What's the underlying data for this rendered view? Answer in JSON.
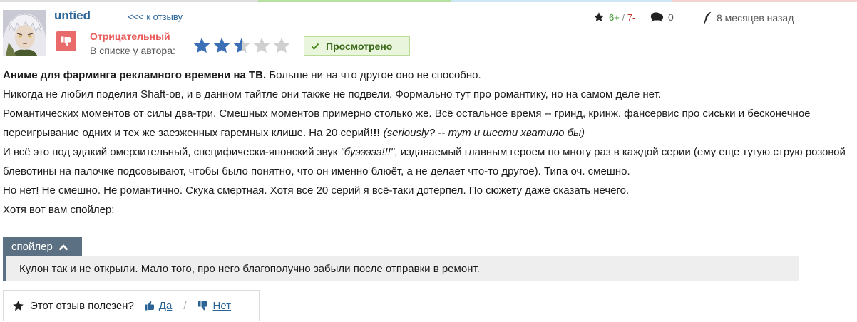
{
  "colors": {
    "topline": [
      "#dedede",
      "#b8e0a0",
      "#cde7f5",
      "#f4d3d3"
    ],
    "accent_link": "#2a6496",
    "negative": "#e85c5c",
    "star_filled": "#3b6fb6",
    "star_empty": "#d0d0d0",
    "spoiler": "#5b7183"
  },
  "author": {
    "username": "untied",
    "back_link": "<<< к отзыву"
  },
  "rating": {
    "verdict": "Отрицательный",
    "in_list_label": "В списке у автора:",
    "stars_value": 2.5,
    "stars_max": 5
  },
  "status_badge": "Просмотрено",
  "meta": {
    "score_pos": "6+",
    "score_sep": "/",
    "score_neg": "7-",
    "comments": "0",
    "time": "8 месяцев назад"
  },
  "review": {
    "p1_bold": "Аниме для фарминга рекламного времени на ТВ.",
    "p1_rest": " Больше ни на что другое оно не способно.",
    "p2": "Никогда не любил поделия Shaft-ов, и в данном тайтле они также не подвели. Формально тут про романтику, но на самом деле нет.",
    "p3_a": "Романтических моментов от силы два-три. Смешных моментов примерно столько же. Всё остальное время -- гринд, кринж, фансервис про сиськи и бесконечное переигрывание одних и тех же заезженных гаремных клише. На 20 серий",
    "p3_bold": "!!!",
    "p3_space": " ",
    "p3_italic": "(seriously? -- тут и шести хватило бы)",
    "p4_a": "И всё это под эдакий омерзительный, специфически-японский звук ",
    "p4_italic": "\"буэээээ!!!\"",
    "p4_b": ", издаваемый главным героем по многу раз в каждой серии (ему еще тугую струю розовой блевотины на палочке подсовывают, чтобы было понятно, что он именно блюёт, а не делает что-то другое). Типа оч. смешно.",
    "p5": "Но нет! Не смешно. Не романтично. Скука смертная. Хотя все 20 серий я всё-таки дотерпел. По сюжету даже сказать нечего.",
    "p6": "Хотя вот вам спойлер:"
  },
  "spoiler": {
    "button_label": "спойлер",
    "icon": "chevron-up-icon",
    "text": "Кулон так и не открыли. Мало того, про него благополучно забыли после отправки в ремонт."
  },
  "useful": {
    "question": "Этот отзыв полезен?",
    "yes": "Да",
    "separator": "/",
    "no": "Нет"
  }
}
